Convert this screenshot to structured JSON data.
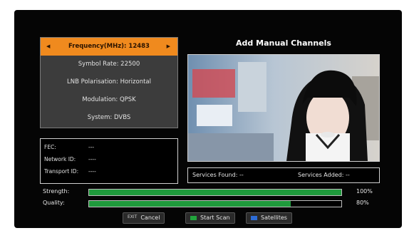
{
  "page": {
    "title": "Add Manual Channels"
  },
  "params": [
    {
      "label": "Frequency(MHz): 12483",
      "selected": true
    },
    {
      "label": "Symbol Rate: 22500",
      "selected": false
    },
    {
      "label": "LNB Polarisation: Horizontal",
      "selected": false
    },
    {
      "label": "Modulation: QPSK",
      "selected": false
    },
    {
      "label": "System: DVBS",
      "selected": false
    }
  ],
  "icons": {
    "left": "arrow-left-icon",
    "right": "arrow-right-icon"
  },
  "info": [
    {
      "label": "FEC:",
      "value": "---"
    },
    {
      "label": "Network ID:",
      "value": "----"
    },
    {
      "label": "Transport ID:",
      "value": "----"
    }
  ],
  "services": {
    "found": "Services Found: --",
    "added": "Services Added: --"
  },
  "meters": [
    {
      "label": "Strength:",
      "value": 100,
      "display": "100%"
    },
    {
      "label": "Quality:",
      "value": 80,
      "display": "80%"
    }
  ],
  "buttons": [
    {
      "key": "EXIT",
      "label": "Cancel"
    },
    {
      "key": "green",
      "label": "Start Scan"
    },
    {
      "key": "blue",
      "label": "Satellites"
    }
  ],
  "colors": {
    "highlight": "#f08a1e",
    "meter": "#1f9a3c",
    "green_key": "#21a53c",
    "blue_key": "#2d6cd6"
  }
}
